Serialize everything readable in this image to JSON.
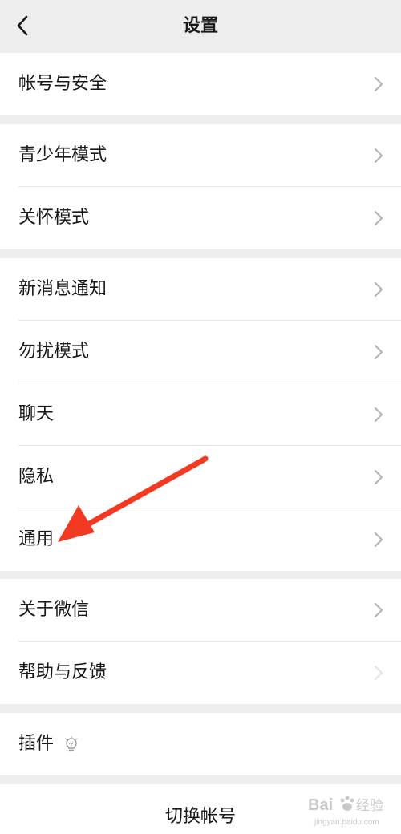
{
  "header": {
    "title": "设置",
    "back_icon": "chevron-left-icon"
  },
  "groups": [
    {
      "items": [
        {
          "label": "帐号与安全"
        }
      ]
    },
    {
      "items": [
        {
          "label": "青少年模式"
        },
        {
          "label": "关怀模式"
        }
      ]
    },
    {
      "items": [
        {
          "label": "新消息通知"
        },
        {
          "label": "勿扰模式"
        },
        {
          "label": "聊天"
        },
        {
          "label": "隐私"
        },
        {
          "label": "通用"
        }
      ]
    },
    {
      "items": [
        {
          "label": "关于微信"
        },
        {
          "label": "帮助与反馈"
        }
      ]
    },
    {
      "items": [
        {
          "label": "插件",
          "icon": "plugin-icon"
        }
      ]
    }
  ],
  "footer": {
    "switch_account_label": "切换帐号"
  },
  "annotation": {
    "arrow_color": "#f23a22",
    "points_to": "通用"
  },
  "colors": {
    "background": "#ededed",
    "cell": "#ffffff",
    "text": "#191919",
    "chevron": "#b2b2b2"
  }
}
